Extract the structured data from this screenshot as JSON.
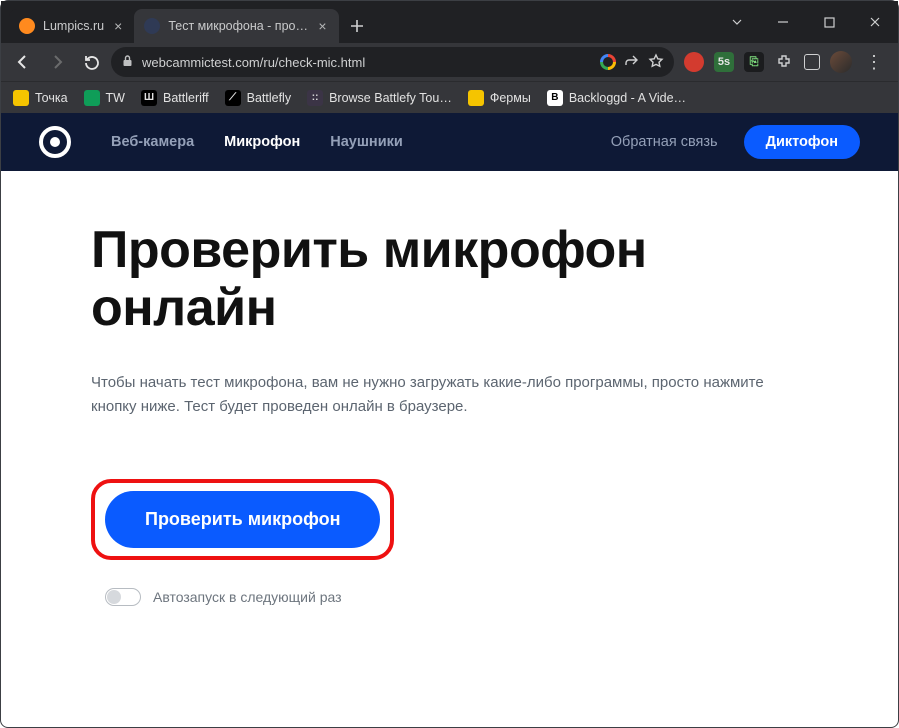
{
  "browser": {
    "tabs": [
      {
        "title": "Lumpics.ru",
        "active": false,
        "favicon_color": "#ff8a1e"
      },
      {
        "title": "Тест микрофона - проверка ми",
        "active": true,
        "favicon_color": "#2f3a55"
      }
    ],
    "url_display": "webcammictest.com/ru/check-mic.html",
    "ext_badge": "5s",
    "bookmarks": [
      {
        "label": "Точка",
        "color": "#f5c400",
        "glyph": ""
      },
      {
        "label": "TW",
        "color": "#0f9d58",
        "glyph": ""
      },
      {
        "label": "Battleriff",
        "color": "#000000",
        "glyph": "Ш"
      },
      {
        "label": "Battlefly",
        "color": "#000000",
        "glyph": "⟋"
      },
      {
        "label": "Browse Battlefy Tou…",
        "color": "#3b3446",
        "glyph": "::"
      },
      {
        "label": "Фермы",
        "color": "#f5c400",
        "glyph": ""
      },
      {
        "label": "Backloggd - A Vide…",
        "color": "#ffffff",
        "glyph": "B"
      }
    ]
  },
  "site_nav": {
    "links": [
      {
        "label": "Веб-камера",
        "active": false
      },
      {
        "label": "Микрофон",
        "active": true
      },
      {
        "label": "Наушники",
        "active": false
      }
    ],
    "feedback": "Обратная связь",
    "cta": "Диктофон"
  },
  "page": {
    "headline": "Проверить микрофон онлайн",
    "lede": "Чтобы начать тест микрофона, вам не нужно загружать какие-либо программы, просто нажмите кнопку ниже. Тест будет проведен онлайн в браузере.",
    "check_button": "Проверить микрофон",
    "autostart_label": "Автозапуск в следующий раз"
  }
}
